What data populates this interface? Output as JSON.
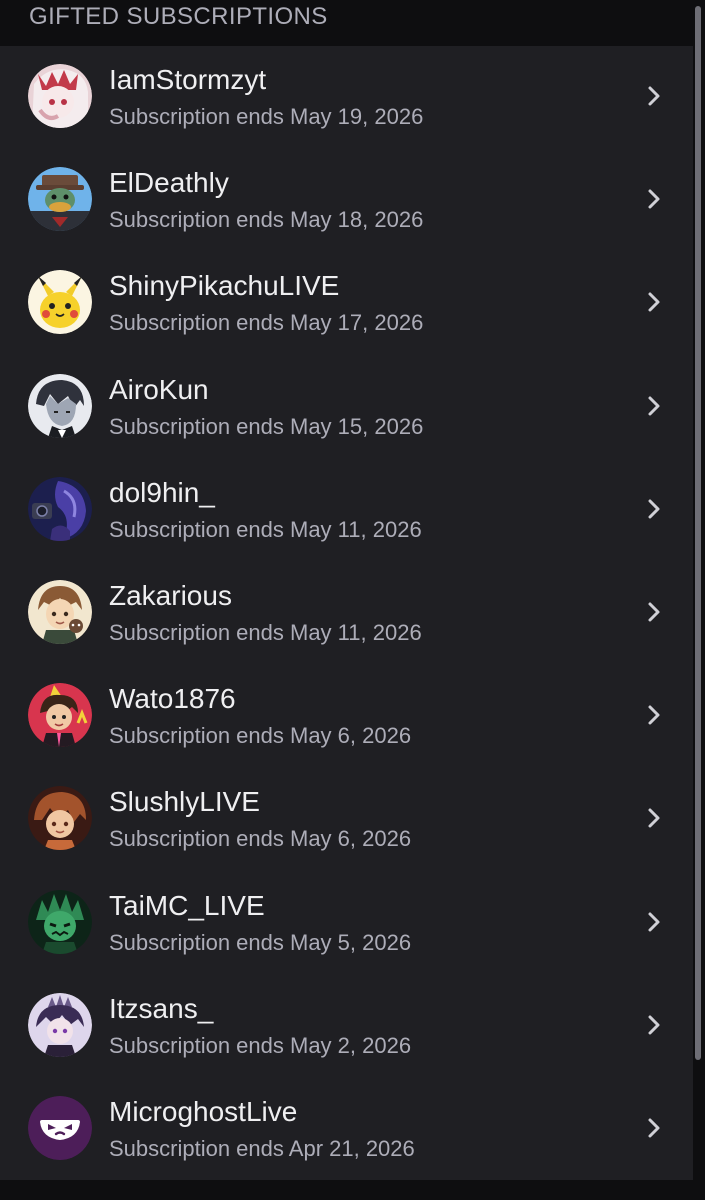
{
  "section": {
    "title": "GIFTED SUBSCRIPTIONS"
  },
  "subscriptions": [
    {
      "username": "IamStormzyt",
      "ends": "Subscription ends May 19, 2026",
      "avatar_icon": "anime-avatar-icon",
      "avatar_colors": [
        "#f3e3e6",
        "#c23a4a"
      ]
    },
    {
      "username": "ElDeathly",
      "ends": "Subscription ends May 18, 2026",
      "avatar_icon": "duck-avatar-icon",
      "avatar_colors": [
        "#5aa9e6",
        "#4f7a5a"
      ]
    },
    {
      "username": "ShinyPikachuLIVE",
      "ends": "Subscription ends May 17, 2026",
      "avatar_icon": "pikachu-avatar-icon",
      "avatar_colors": [
        "#fbf7e8",
        "#f6d12b"
      ]
    },
    {
      "username": "AiroKun",
      "ends": "Subscription ends May 15, 2026",
      "avatar_icon": "anime-avatar-icon",
      "avatar_colors": [
        "#e6e8ee",
        "#3a3e4a"
      ]
    },
    {
      "username": "dol9hin_",
      "ends": "Subscription ends May 11, 2026",
      "avatar_icon": "anime-avatar-icon",
      "avatar_colors": [
        "#1b1d4a",
        "#5b4bb8"
      ]
    },
    {
      "username": "Zakarious",
      "ends": "Subscription ends May 11, 2026",
      "avatar_icon": "anime-avatar-icon",
      "avatar_colors": [
        "#f2e6cf",
        "#8a5a35"
      ]
    },
    {
      "username": "Wato1876",
      "ends": "Subscription ends May 6, 2026",
      "avatar_icon": "anime-avatar-icon",
      "avatar_colors": [
        "#d8364f",
        "#2a1e2a"
      ]
    },
    {
      "username": "SlushlyLIVE",
      "ends": "Subscription ends May 6, 2026",
      "avatar_icon": "anime-avatar-icon",
      "avatar_colors": [
        "#5a2a1e",
        "#c76a3a"
      ]
    },
    {
      "username": "TaiMC_LIVE",
      "ends": "Subscription ends May 5, 2026",
      "avatar_icon": "anime-avatar-icon",
      "avatar_colors": [
        "#0e2a1c",
        "#3fa86a"
      ]
    },
    {
      "username": "Itzsans_",
      "ends": "Subscription ends May 2, 2026",
      "avatar_icon": "anime-avatar-icon",
      "avatar_colors": [
        "#d9d2ea",
        "#3e2e5a"
      ]
    },
    {
      "username": "MicroghostLive",
      "ends": "Subscription ends Apr 21, 2026",
      "avatar_icon": "ghost-avatar-icon",
      "avatar_colors": [
        "#4d1e59",
        "#ffffff"
      ]
    }
  ],
  "icons": {
    "row_action": "chevron-right-icon"
  },
  "colors": {
    "background": "#0e0e10",
    "list_background": "#1f1f23",
    "text_primary": "#efeff1",
    "text_secondary": "#adadb8",
    "chevron": "#d0d0d6"
  }
}
